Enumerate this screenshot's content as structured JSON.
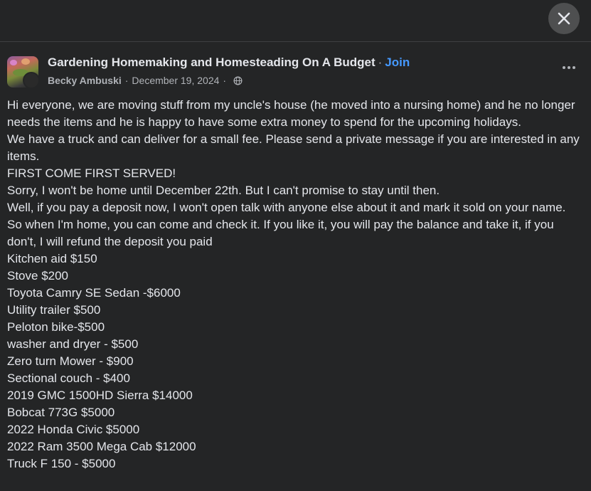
{
  "post": {
    "group_name": "Gardening Homemaking and Homesteading On A Budget",
    "separator": "·",
    "join_label": "Join",
    "author": "Becky Ambuski",
    "date": "December 19, 2024",
    "privacy_icon": "globe-icon",
    "paragraphs": [
      "Hi everyone, we are moving stuff from my uncle's house (he moved into a nursing home) and he no longer needs the items and he is happy to have some extra money to spend for the upcoming holidays.",
      "We have a truck and can deliver for a small fee. Please send a private message if you are interested in any items.",
      "FIRST COME FIRST SERVED!",
      "Sorry, I won't be home until December 22th. But I can't promise to stay until then.",
      "Well, if you pay a deposit now, I won't open talk with anyone else about it and mark it sold on your name. So when I'm home, you can come and check it. If you like it, you will pay the balance and take it, if you don't, I will refund the deposit you paid",
      "Kitchen aid $150",
      "Stove $200",
      "Toyota Camry SE Sedan -$6000",
      "Utility trailer $500",
      "Peloton bike-$500",
      "washer and dryer - $500",
      "Zero turn Mower - $900",
      "Sectional couch - $400",
      "2019 GMC 1500HD Sierra $14000",
      "Bobcat 773G $5000",
      "2022 Honda Civic $5000",
      "2022 Ram 3500 Mega Cab $12000",
      "Truck F 150 - $5000"
    ]
  },
  "colors": {
    "background": "#242526",
    "text_primary": "#e4e6eb",
    "text_secondary": "#b0b3b8",
    "link": "#4599ff"
  }
}
